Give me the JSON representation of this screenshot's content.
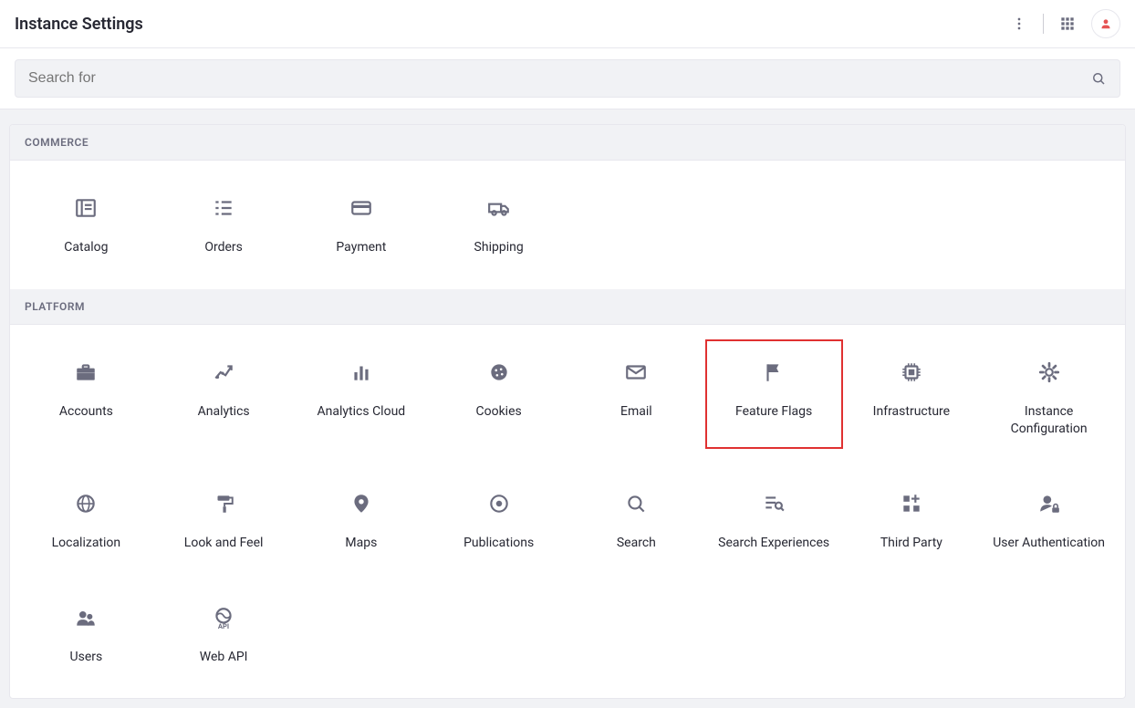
{
  "header": {
    "title": "Instance Settings"
  },
  "search": {
    "placeholder": "Search for"
  },
  "sections": [
    {
      "title": "COMMERCE",
      "items": [
        {
          "label": "Catalog",
          "icon": "catalog"
        },
        {
          "label": "Orders",
          "icon": "orders"
        },
        {
          "label": "Payment",
          "icon": "payment"
        },
        {
          "label": "Shipping",
          "icon": "shipping"
        }
      ]
    },
    {
      "title": "PLATFORM",
      "items": [
        {
          "label": "Accounts",
          "icon": "briefcase"
        },
        {
          "label": "Analytics",
          "icon": "analytics"
        },
        {
          "label": "Analytics Cloud",
          "icon": "bar-chart"
        },
        {
          "label": "Cookies",
          "icon": "cookies"
        },
        {
          "label": "Email",
          "icon": "email"
        },
        {
          "label": "Feature Flags",
          "icon": "flag",
          "highlight": true
        },
        {
          "label": "Infrastructure",
          "icon": "chip"
        },
        {
          "label": "Instance Configuration",
          "icon": "gear"
        },
        {
          "label": "Localization",
          "icon": "globe"
        },
        {
          "label": "Look and Feel",
          "icon": "paint-roller"
        },
        {
          "label": "Maps",
          "icon": "map-pin"
        },
        {
          "label": "Publications",
          "icon": "target"
        },
        {
          "label": "Search",
          "icon": "magnifier"
        },
        {
          "label": "Search Experiences",
          "icon": "search-list"
        },
        {
          "label": "Third Party",
          "icon": "widgets"
        },
        {
          "label": "User Authentication",
          "icon": "user-lock"
        },
        {
          "label": "Users",
          "icon": "users"
        },
        {
          "label": "Web API",
          "icon": "api"
        }
      ]
    }
  ]
}
